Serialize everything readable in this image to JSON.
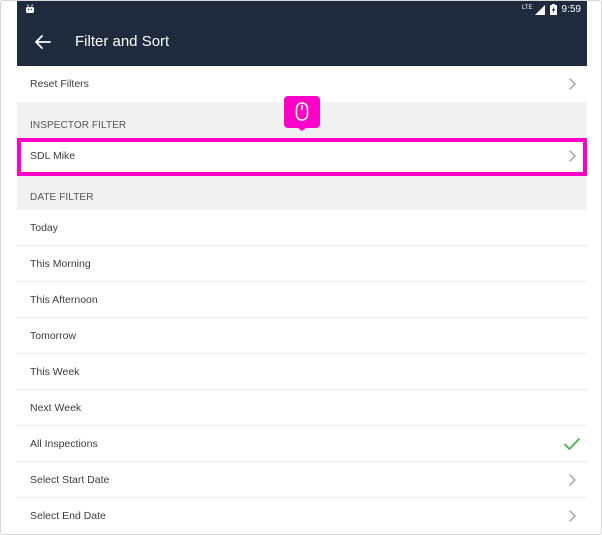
{
  "status_bar": {
    "network": "LTE",
    "time": "9:59"
  },
  "app_bar": {
    "title": "Filter and Sort"
  },
  "reset_filters": {
    "label": "Reset Filters"
  },
  "inspector_filter": {
    "header": "INSPECTOR FILTER",
    "selected_inspector": "SDL Mike"
  },
  "date_filter": {
    "header": "DATE FILTER",
    "options": [
      {
        "label": "Today",
        "selected": false
      },
      {
        "label": "This Morning",
        "selected": false
      },
      {
        "label": "This Afternoon",
        "selected": false
      },
      {
        "label": "Tomorrow",
        "selected": false
      },
      {
        "label": "This Week",
        "selected": false
      },
      {
        "label": "Next Week",
        "selected": false
      },
      {
        "label": "All Inspections",
        "selected": true
      }
    ],
    "select_start_date": "Select Start Date",
    "select_end_date": "Select End Date"
  },
  "colors": {
    "app_bar": "#1e2b3d",
    "highlight": "#ff00c8",
    "check": "#4caf50",
    "section_header_bg": "#f1f1f1"
  }
}
